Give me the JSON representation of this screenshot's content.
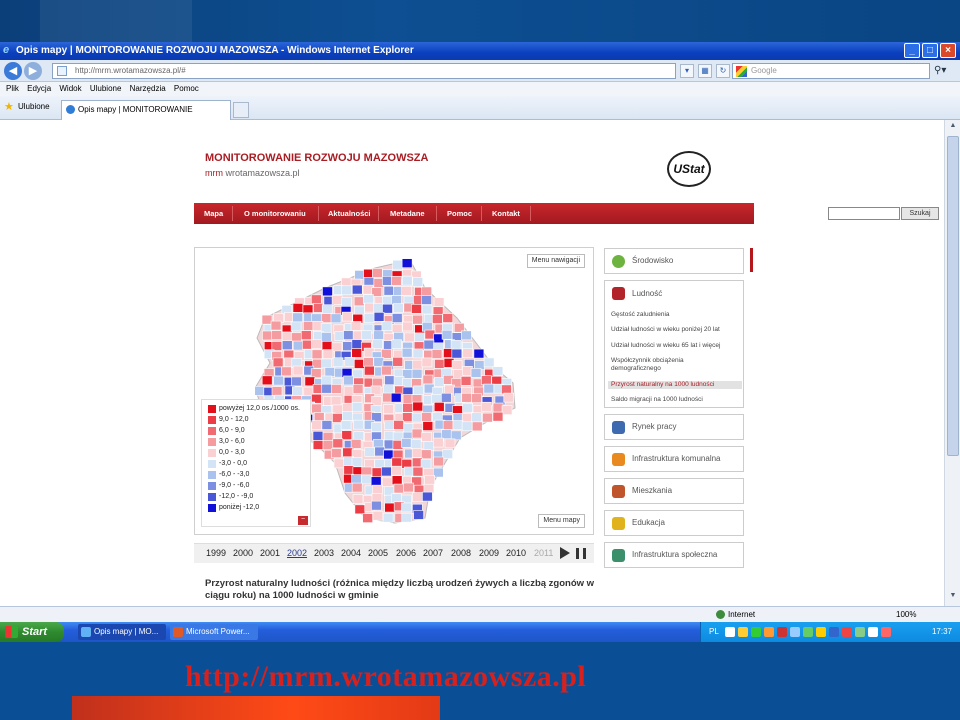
{
  "slide": {
    "url_text": "http://mrm.wrotamazowsza.pl"
  },
  "window": {
    "title": "Opis mapy | MONITOROWANIE ROZWOJU MAZOWSZA - Windows Internet Explorer",
    "address": "http://mrm.wrotamazowsza.pl/#",
    "search_placeholder": "Google",
    "menu": [
      "Plik",
      "Edycja",
      "Widok",
      "Ulubione",
      "Narzędzia",
      "Pomoc"
    ],
    "favorites_label": "Ulubione",
    "tab_label": "Opis mapy | MONITOROWANIE ROZWO...",
    "status_zone": "Internet",
    "zoom": "100%"
  },
  "site": {
    "title": "MONITOROWANIE ROZWOJU MAZOWSZA",
    "subtitle_brand": "mrm",
    "subtitle_rest": " wrotamazowsza.pl",
    "logo_text": "UStat",
    "nav": [
      "Mapa",
      "O monitorowaniu",
      "Aktualności",
      "Metadane",
      "Pomoc",
      "Kontakt"
    ],
    "search_button": "Szukaj",
    "map_nav_button": "Menu nawigacji",
    "map_menu_button": "Menu mapy",
    "legend": [
      {
        "label": "powyżej 12,0 os./1000 os.",
        "color": "#e3101c"
      },
      {
        "label": "9,0 - 12,0",
        "color": "#ec3c45"
      },
      {
        "label": "6,0 - 9,0",
        "color": "#f16a71"
      },
      {
        "label": "3,0 - 6,0",
        "color": "#f59ca0"
      },
      {
        "label": "0,0 - 3,0",
        "color": "#fad0d2"
      },
      {
        "label": "-3,0 - 0,0",
        "color": "#d2e4f6"
      },
      {
        "label": "-6,0 - -3,0",
        "color": "#a9c2ee"
      },
      {
        "label": "-9,0 - -6,0",
        "color": "#7c8fe0"
      },
      {
        "label": "-12,0 - -9,0",
        "color": "#4a58d8"
      },
      {
        "label": "poniżej -12,0",
        "color": "#1010d8"
      }
    ],
    "legend_close": "−",
    "years": [
      "1999",
      "2000",
      "2001",
      "2002",
      "2003",
      "2004",
      "2005",
      "2006",
      "2007",
      "2008",
      "2009",
      "2010",
      "2011"
    ],
    "active_year": "2002",
    "disabled_year": "2011",
    "caption": "Przyrost naturalny ludności (różnica między liczbą urodzeń żywych a liczbą zgonów w ciągu roku) na 1000 ludności w gminie",
    "sidebar": {
      "srodowisko": "Środowisko",
      "ludnosc": "Ludność",
      "ludnosc_items": [
        "Gęstość zaludnienia",
        "Udział ludności w wieku poniżej 20 lat",
        "Udział ludności w wieku 65 lat i więcej",
        "Współczynnik obciążenia demograficznego",
        "Przyrost naturalny na 1000 ludności",
        "Saldo migracji na 1000 ludności"
      ],
      "rynek_pracy": "Rynek pracy",
      "infrastruktura_komunalna": "Infrastruktura komunalna",
      "mieszkania": "Mieszkania",
      "edukacja": "Edukacja",
      "infrastruktura_spoleczna": "Infrastruktura społeczna"
    }
  },
  "taskbar": {
    "start": "Start",
    "task1": "Opis mapy | MO...",
    "task2": "Microsoft Power...",
    "lang": "PL",
    "clock": "17:37"
  }
}
